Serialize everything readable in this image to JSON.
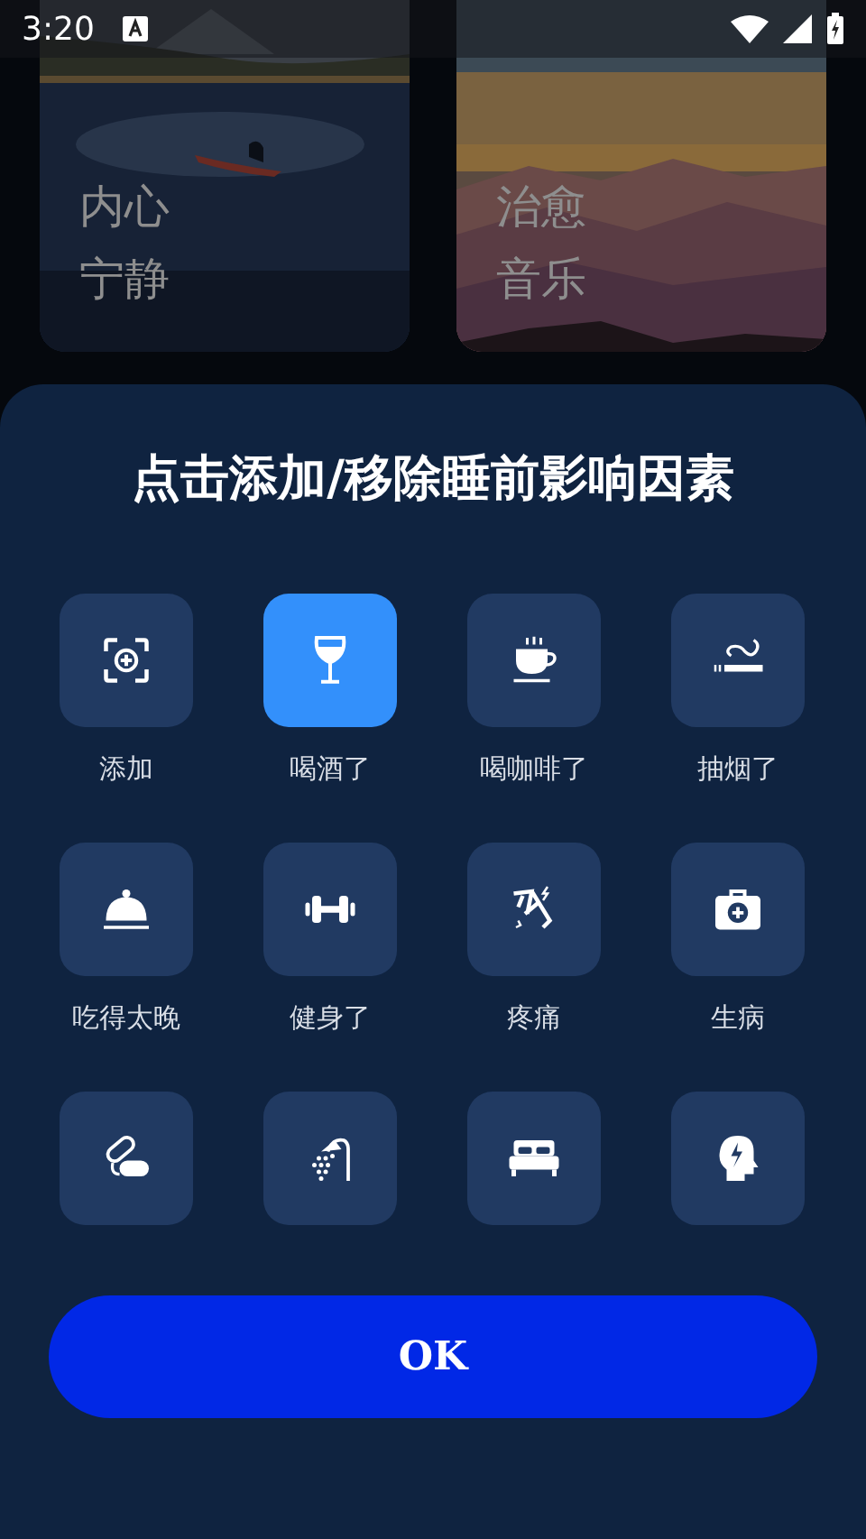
{
  "status_bar": {
    "time": "3:20"
  },
  "cards": [
    {
      "title": "内心宁静"
    },
    {
      "title": "治愈音乐"
    }
  ],
  "sheet": {
    "title": "点击添加/移除睡前影响因素",
    "factors": [
      {
        "label": "添加",
        "selected": false
      },
      {
        "label": "喝酒了",
        "selected": true
      },
      {
        "label": "喝咖啡了",
        "selected": false
      },
      {
        "label": "抽烟了",
        "selected": false
      },
      {
        "label": "吃得太晚",
        "selected": false
      },
      {
        "label": "健身了",
        "selected": false
      },
      {
        "label": "疼痛",
        "selected": false
      },
      {
        "label": "生病",
        "selected": false
      },
      {
        "selected": false
      },
      {
        "selected": false
      },
      {
        "selected": false
      },
      {
        "selected": false
      }
    ],
    "button": "OK"
  }
}
